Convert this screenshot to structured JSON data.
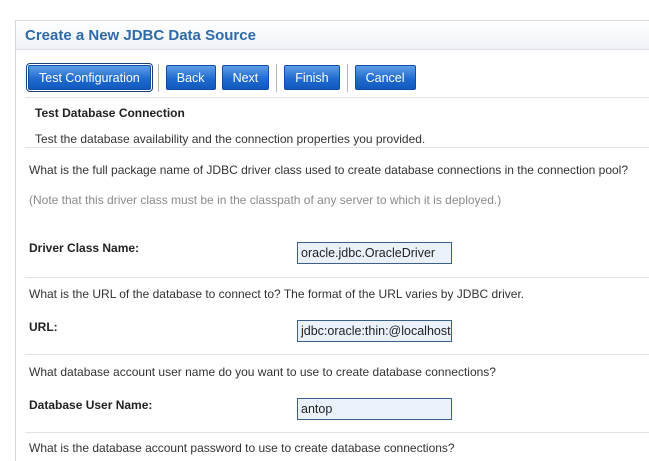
{
  "title": "Create a New JDBC Data Source",
  "buttons": {
    "test_configuration": "Test Configuration",
    "back": "Back",
    "next": "Next",
    "finish": "Finish",
    "cancel": "Cancel"
  },
  "section": {
    "title": "Test Database Connection",
    "description": "Test the database availability and the connection properties you provided."
  },
  "driver": {
    "question": "What is the full package name of JDBC driver class used to create database connections in the connection pool?",
    "note": "(Note that this driver class must be in the classpath of any server to which it is deployed.)",
    "label": "Driver Class Name:",
    "value": "oracle.jdbc.OracleDriver"
  },
  "url": {
    "question": "What is the URL of the database to connect to? The format of the URL varies by JDBC driver.",
    "label": "URL:",
    "value": "jdbc:oracle:thin:@localhost"
  },
  "user": {
    "question": "What database account user name do you want to use to create database connections?",
    "label": "Database User Name:",
    "value": "antop"
  },
  "password": {
    "question": "What is the database account password to use to create database connections?"
  },
  "colors": {
    "title": "#2e6aa8",
    "button": "#1f6cd0",
    "field_bg": "#eaf1fb"
  }
}
